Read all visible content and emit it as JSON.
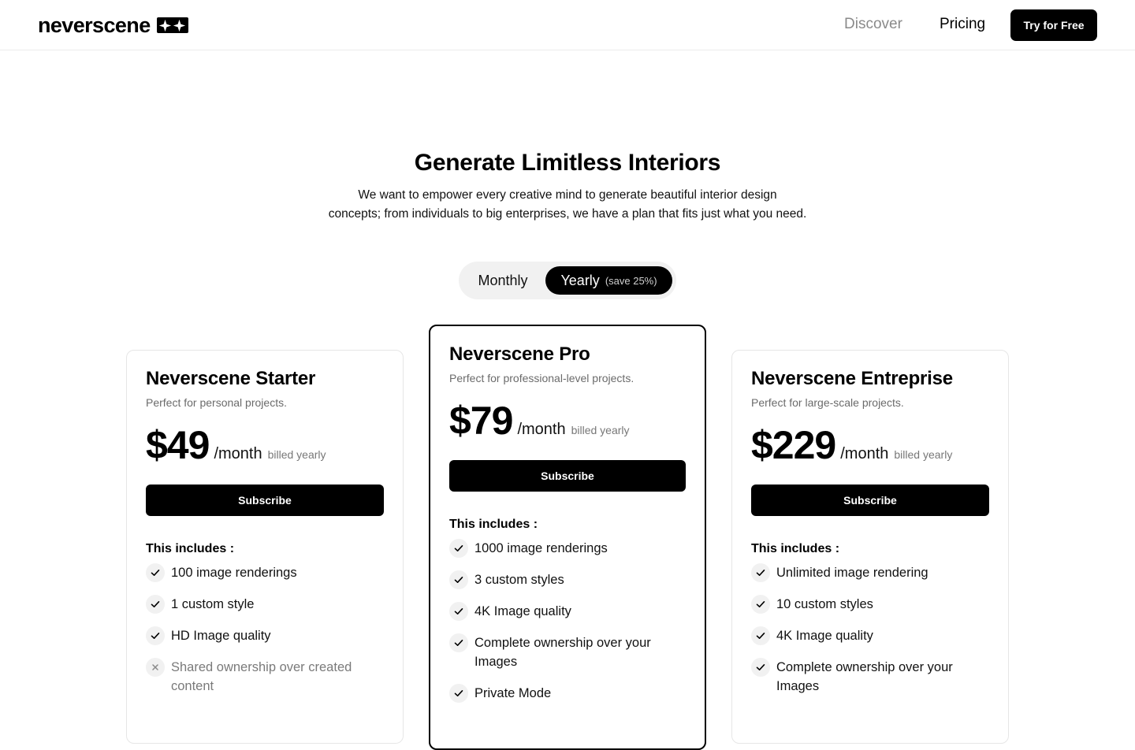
{
  "header": {
    "logo_text": "neverscene",
    "nav": {
      "discover": "Discover",
      "pricing": "Pricing"
    },
    "cta_label": "Try for Free"
  },
  "hero": {
    "title": "Generate Limitless Interiors",
    "subtitle_line1": "We want to empower every creative mind to generate beautiful interior design",
    "subtitle_line2": "concepts; from individuals to big enterprises, we have a plan that fits just what you need."
  },
  "billing_toggle": {
    "monthly": "Monthly",
    "yearly": "Yearly",
    "yearly_note": "(save 25%)",
    "selected": "Yearly"
  },
  "plans": [
    {
      "name": "Neverscene Starter",
      "description": "Perfect for personal projects.",
      "price": "$49",
      "period": "/month",
      "billing": "billed yearly",
      "button": "Subscribe",
      "includes_label": "This includes :",
      "features": [
        {
          "text": "100 image renderings",
          "included": true,
          "icon": "check-icon"
        },
        {
          "text": "1 custom style",
          "included": true,
          "icon": "check-icon"
        },
        {
          "text": "HD Image quality",
          "included": true,
          "icon": "check-icon"
        },
        {
          "text": "Shared ownership over created content",
          "included": false,
          "icon": "cross-icon"
        }
      ]
    },
    {
      "name": "Neverscene Pro",
      "description": "Perfect for professional-level projects.",
      "price": "$79",
      "period": "/month",
      "billing": "billed yearly",
      "button": "Subscribe",
      "includes_label": "This includes :",
      "features": [
        {
          "text": "1000 image renderings",
          "included": true,
          "icon": "check-icon"
        },
        {
          "text": "3 custom styles",
          "included": true,
          "icon": "check-icon"
        },
        {
          "text": "4K Image quality",
          "included": true,
          "icon": "check-icon"
        },
        {
          "text": "Complete ownership over your Images",
          "included": true,
          "icon": "check-icon"
        },
        {
          "text": "Private Mode",
          "included": true,
          "icon": "check-icon"
        }
      ]
    },
    {
      "name": "Neverscene Entreprise",
      "description": "Perfect for large-scale projects.",
      "price": "$229",
      "period": "/month",
      "billing": "billed yearly",
      "button": "Subscribe",
      "includes_label": "This includes :",
      "features": [
        {
          "text": "Unlimited image rendering",
          "included": true,
          "icon": "check-icon"
        },
        {
          "text": "10 custom styles",
          "included": true,
          "icon": "check-icon"
        },
        {
          "text": "4K Image quality",
          "included": true,
          "icon": "check-icon"
        },
        {
          "text": "Complete ownership over your Images",
          "included": true,
          "icon": "check-icon"
        }
      ]
    }
  ],
  "colors": {
    "accent": "#000000",
    "background": "#ffffff",
    "muted_text": "#6b6b6b",
    "nav_inactive": "#8a8a8a",
    "toggle_bg": "#f1f1f1",
    "icon_bg": "#f1f1f1"
  }
}
